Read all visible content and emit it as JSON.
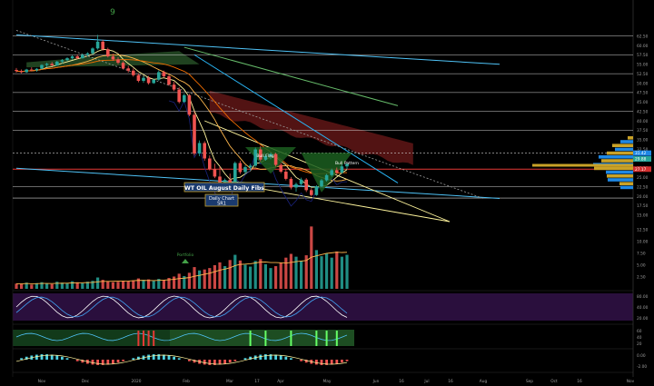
{
  "chart_data": {
    "type": "candlestick",
    "annotations": {
      "title_box": "WT OIL August Daily Fibs",
      "subtitle_line1": "Daily Chart",
      "subtitle_line2": "SR1",
      "volume_tag": "Portfolio",
      "pattern_label_left": "Bull Flag",
      "pattern_label_right": "Bull Pattern",
      "td_count": "9"
    },
    "price_axis_ticks": [
      "62.50",
      "60.00",
      "57.50",
      "55.00",
      "52.50",
      "50.00",
      "47.50",
      "45.00",
      "42.50",
      "40.00",
      "37.50",
      "35.00",
      "32.50",
      "30.00",
      "27.50",
      "25.00",
      "22.50",
      "20.00",
      "17.50",
      "15.00"
    ],
    "price_tags": [
      {
        "text": "31.42",
        "color": "#1e88e5"
      },
      {
        "text": "29.88",
        "color": "#26a69a"
      },
      {
        "text": "27.17",
        "color": "#d32f2f"
      }
    ],
    "volume_axis_ticks": [
      "12.50",
      "10.00",
      "7.50",
      "5.00",
      "2.50"
    ],
    "stoch_axis_ticks": [
      "80.00",
      "40.00",
      "20.00"
    ],
    "ind2_axis_ticks": [
      "60",
      "40",
      "20"
    ],
    "macd_axis_ticks": [
      "0.00",
      "-2.00"
    ],
    "time_axis_labels": [
      "Nov",
      "Dec",
      "2020",
      "Feb",
      "Mar",
      "17",
      "Apr",
      "May",
      "Jun",
      "16",
      "Jul",
      "16",
      "Aug",
      "Sep",
      "Oct",
      "16",
      "Nov"
    ],
    "candles": [
      [
        53.5,
        54.0,
        52.8,
        53.2
      ],
      [
        53.2,
        53.6,
        52.6,
        52.9
      ],
      [
        52.9,
        53.8,
        52.7,
        53.6
      ],
      [
        53.6,
        54.2,
        53.1,
        53.4
      ],
      [
        53.4,
        54.0,
        53.0,
        53.8
      ],
      [
        53.8,
        55.0,
        53.6,
        54.8
      ],
      [
        54.8,
        55.4,
        54.2,
        55.1
      ],
      [
        55.1,
        55.6,
        54.5,
        54.7
      ],
      [
        54.7,
        55.9,
        54.6,
        55.7
      ],
      [
        55.7,
        56.4,
        55.2,
        56.1
      ],
      [
        56.1,
        56.9,
        55.8,
        56.6
      ],
      [
        56.6,
        57.4,
        56.2,
        57.1
      ],
      [
        57.1,
        57.6,
        56.3,
        56.6
      ],
      [
        56.6,
        57.8,
        56.5,
        57.5
      ],
      [
        57.5,
        58.2,
        57.0,
        57.9
      ],
      [
        57.9,
        59.5,
        57.6,
        59.2
      ],
      [
        59.2,
        62.8,
        58.9,
        61.0
      ],
      [
        61.0,
        61.5,
        58.6,
        59.0
      ],
      [
        59.0,
        59.4,
        56.8,
        57.1
      ],
      [
        57.1,
        57.8,
        55.9,
        56.3
      ],
      [
        56.3,
        56.9,
        55.0,
        55.4
      ],
      [
        55.4,
        55.8,
        53.6,
        53.9
      ],
      [
        53.9,
        54.6,
        52.8,
        53.3
      ],
      [
        53.3,
        53.9,
        51.7,
        52.1
      ],
      [
        52.1,
        52.6,
        50.2,
        50.6
      ],
      [
        50.6,
        51.8,
        50.1,
        51.4
      ],
      [
        51.4,
        51.9,
        49.6,
        50.0
      ],
      [
        50.0,
        51.2,
        49.8,
        50.9
      ],
      [
        50.9,
        53.4,
        50.6,
        52.9
      ],
      [
        52.9,
        53.3,
        51.5,
        51.8
      ],
      [
        51.8,
        52.3,
        49.3,
        49.6
      ],
      [
        49.6,
        50.4,
        47.9,
        48.3
      ],
      [
        48.3,
        48.9,
        44.6,
        45.0
      ],
      [
        45.0,
        47.2,
        44.8,
        46.8
      ],
      [
        46.8,
        47.1,
        41.2,
        41.6
      ],
      [
        41.6,
        42.5,
        30.8,
        31.3
      ],
      [
        31.3,
        34.8,
        30.6,
        34.1
      ],
      [
        34.1,
        34.6,
        29.4,
        30.0
      ],
      [
        30.0,
        30.8,
        26.8,
        27.2
      ],
      [
        27.2,
        28.6,
        24.8,
        25.2
      ],
      [
        25.2,
        27.9,
        22.4,
        23.1
      ],
      [
        23.1,
        24.7,
        22.0,
        24.3
      ],
      [
        24.3,
        26.0,
        21.4,
        22.5
      ],
      [
        22.5,
        29.2,
        22.3,
        28.8
      ],
      [
        28.8,
        29.4,
        25.9,
        26.4
      ],
      [
        26.4,
        28.2,
        25.8,
        27.7
      ],
      [
        27.7,
        28.6,
        26.9,
        28.1
      ],
      [
        28.1,
        32.9,
        27.8,
        32.4
      ],
      [
        32.4,
        33.3,
        29.2,
        29.7
      ],
      [
        29.7,
        31.1,
        29.4,
        30.6
      ],
      [
        30.6,
        31.6,
        29.8,
        31.2
      ],
      [
        31.2,
        31.5,
        27.9,
        28.3
      ],
      [
        28.3,
        28.8,
        26.1,
        26.5
      ],
      [
        26.5,
        27.3,
        24.2,
        24.6
      ],
      [
        24.6,
        25.1,
        21.8,
        22.3
      ],
      [
        22.3,
        23.6,
        21.2,
        23.2
      ],
      [
        23.2,
        24.9,
        22.9,
        24.4
      ],
      [
        24.4,
        24.8,
        21.1,
        21.6
      ],
      [
        21.6,
        22.1,
        19.9,
        20.3
      ],
      [
        20.3,
        22.9,
        20.1,
        22.6
      ],
      [
        22.6,
        24.6,
        22.4,
        24.2
      ],
      [
        24.2,
        25.9,
        23.9,
        25.6
      ],
      [
        25.6,
        27.3,
        25.2,
        26.9
      ],
      [
        26.9,
        27.6,
        25.8,
        26.2
      ],
      [
        26.2,
        28.4,
        26.0,
        27.9
      ],
      [
        27.9,
        28.8,
        27.1,
        28.6
      ]
    ],
    "volume_values": [
      1.1,
      1.0,
      1.3,
      0.9,
      1.2,
      1.4,
      1.1,
      1.0,
      1.5,
      1.3,
      1.2,
      1.6,
      1.4,
      1.2,
      1.5,
      1.7,
      2.4,
      1.9,
      1.6,
      1.4,
      1.5,
      1.7,
      1.6,
      1.8,
      2.2,
      1.9,
      2.0,
      1.7,
      2.1,
      1.9,
      2.3,
      2.6,
      3.2,
      2.7,
      3.4,
      4.6,
      3.9,
      4.1,
      4.4,
      5.0,
      5.6,
      4.8,
      6.1,
      7.2,
      6.0,
      5.1,
      4.7,
      5.9,
      6.3,
      5.2,
      4.4,
      4.8,
      5.5,
      6.6,
      7.4,
      6.8,
      5.9,
      7.1,
      13.2,
      8.2,
      6.9,
      7.5,
      6.6,
      7.9,
      6.8,
      7.2
    ],
    "fib_lines": [
      62.5,
      57.5,
      52.5,
      47.5,
      42.5,
      37.5,
      31.5,
      27.17,
      22.5,
      19.5
    ],
    "trendlines": [
      {
        "name": "upper",
        "from": [
          0,
          62.8
        ],
        "to": [
          95,
          55.0
        ],
        "color": "#4fc3f7"
      },
      {
        "name": "lower",
        "from": [
          0,
          27.4
        ],
        "to": [
          95,
          19.4
        ],
        "color": "#4fc3f7"
      },
      {
        "name": "mid",
        "from": [
          35,
          57.5
        ],
        "to": [
          75,
          23.5
        ],
        "color": "#29b6f6"
      },
      {
        "name": "dotted",
        "from": [
          0,
          64.0
        ],
        "to": [
          92,
          19.3
        ],
        "color": "#9e9e9e"
      },
      {
        "name": "green",
        "from": [
          33,
          59.5
        ],
        "to": [
          75,
          44.0
        ],
        "color": "#66bb6a"
      }
    ]
  }
}
